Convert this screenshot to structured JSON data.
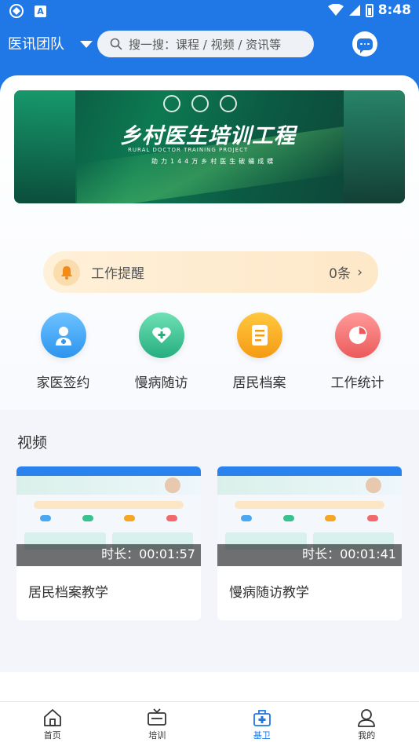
{
  "status_bar": {
    "time": "8:48"
  },
  "header": {
    "team_name": "医讯团队",
    "search_placeholder": "搜一搜：课程 / 视频 / 资讯等"
  },
  "banner": {
    "title": "乡村医生培训工程",
    "subtitle": "RURAL DOCTOR TRAINING PROJECT",
    "slogan": "助力144万乡村医生破蛹成蝶"
  },
  "reminder": {
    "label": "工作提醒",
    "count": "0条"
  },
  "functions": [
    {
      "label": "家医签约",
      "icon": "doctor-icon",
      "color": "#3ea4f0"
    },
    {
      "label": "慢病随访",
      "icon": "heart-care-icon",
      "color": "#35c08f"
    },
    {
      "label": "居民档案",
      "icon": "document-icon",
      "color": "#f6a623"
    },
    {
      "label": "工作统计",
      "icon": "pie-chart-icon",
      "color": "#f06a6a"
    }
  ],
  "video_section": {
    "title": "视频",
    "videos": [
      {
        "title": "居民档案教学",
        "duration": "时长：00:01:57"
      },
      {
        "title": "慢病随访教学",
        "duration": "时长：00:01:41"
      }
    ]
  },
  "tabbar": {
    "items": [
      {
        "label": "首页",
        "icon": "home-icon"
      },
      {
        "label": "培训",
        "icon": "tv-icon"
      },
      {
        "label": "基卫",
        "icon": "clinic-icon",
        "active": true
      },
      {
        "label": "我的",
        "icon": "person-icon"
      }
    ]
  },
  "colors": {
    "primary": "#1f78e6",
    "reminder_bg": "#fde8c8"
  }
}
